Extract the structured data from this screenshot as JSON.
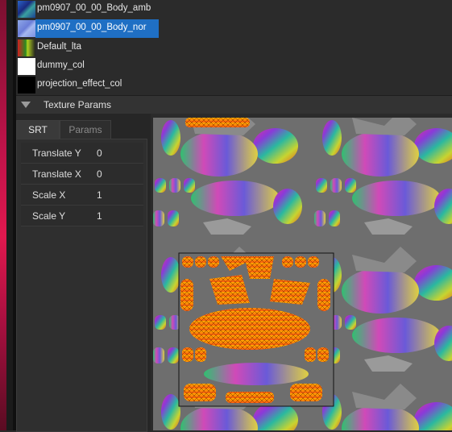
{
  "texture_list": {
    "items": [
      {
        "label": "pm0907_00_00_Body_amb",
        "thumb": "body-amb-thumbnail",
        "selected": false
      },
      {
        "label": "pm0907_00_00_Body_nor",
        "thumb": "body-nor-thumbnail",
        "selected": true
      },
      {
        "label": "Default_lta",
        "thumb": "default-lta-thumbnail",
        "selected": false
      },
      {
        "label": "dummy_col",
        "thumb": "dummy-col-thumbnail",
        "selected": false
      },
      {
        "label": "projection_effect_col",
        "thumb": "projection-effect-thumbnail",
        "selected": false
      }
    ]
  },
  "texture_params": {
    "title": "Texture Params",
    "tabs": {
      "srt": "SRT",
      "params": "Params"
    },
    "active_tab": "SRT",
    "rows": [
      {
        "name": "Translate Y",
        "value": "0"
      },
      {
        "name": "Translate X",
        "value": "0"
      },
      {
        "name": "Scale X",
        "value": "1"
      },
      {
        "name": "Scale Y",
        "value": "1"
      }
    ]
  },
  "colors": {
    "selection": "#1f6fc4",
    "accent_strip": "#e0184e",
    "uv_wire": "#ff8a00"
  }
}
